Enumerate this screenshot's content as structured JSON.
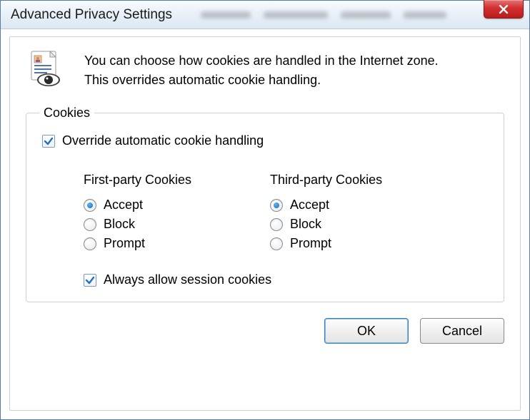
{
  "title": "Advanced Privacy Settings",
  "intro": "You can choose how cookies are handled in the Internet zone.  This overrides automatic cookie handling.",
  "group": {
    "legend": "Cookies",
    "override": {
      "label": "Override automatic cookie handling",
      "checked": true
    },
    "first_party": {
      "title": "First-party Cookies",
      "options": {
        "accept": "Accept",
        "block": "Block",
        "prompt": "Prompt"
      },
      "selected": "accept"
    },
    "third_party": {
      "title": "Third-party Cookies",
      "options": {
        "accept": "Accept",
        "block": "Block",
        "prompt": "Prompt"
      },
      "selected": "accept"
    },
    "session": {
      "label": "Always allow session cookies",
      "checked": true
    }
  },
  "buttons": {
    "ok": "OK",
    "cancel": "Cancel"
  }
}
